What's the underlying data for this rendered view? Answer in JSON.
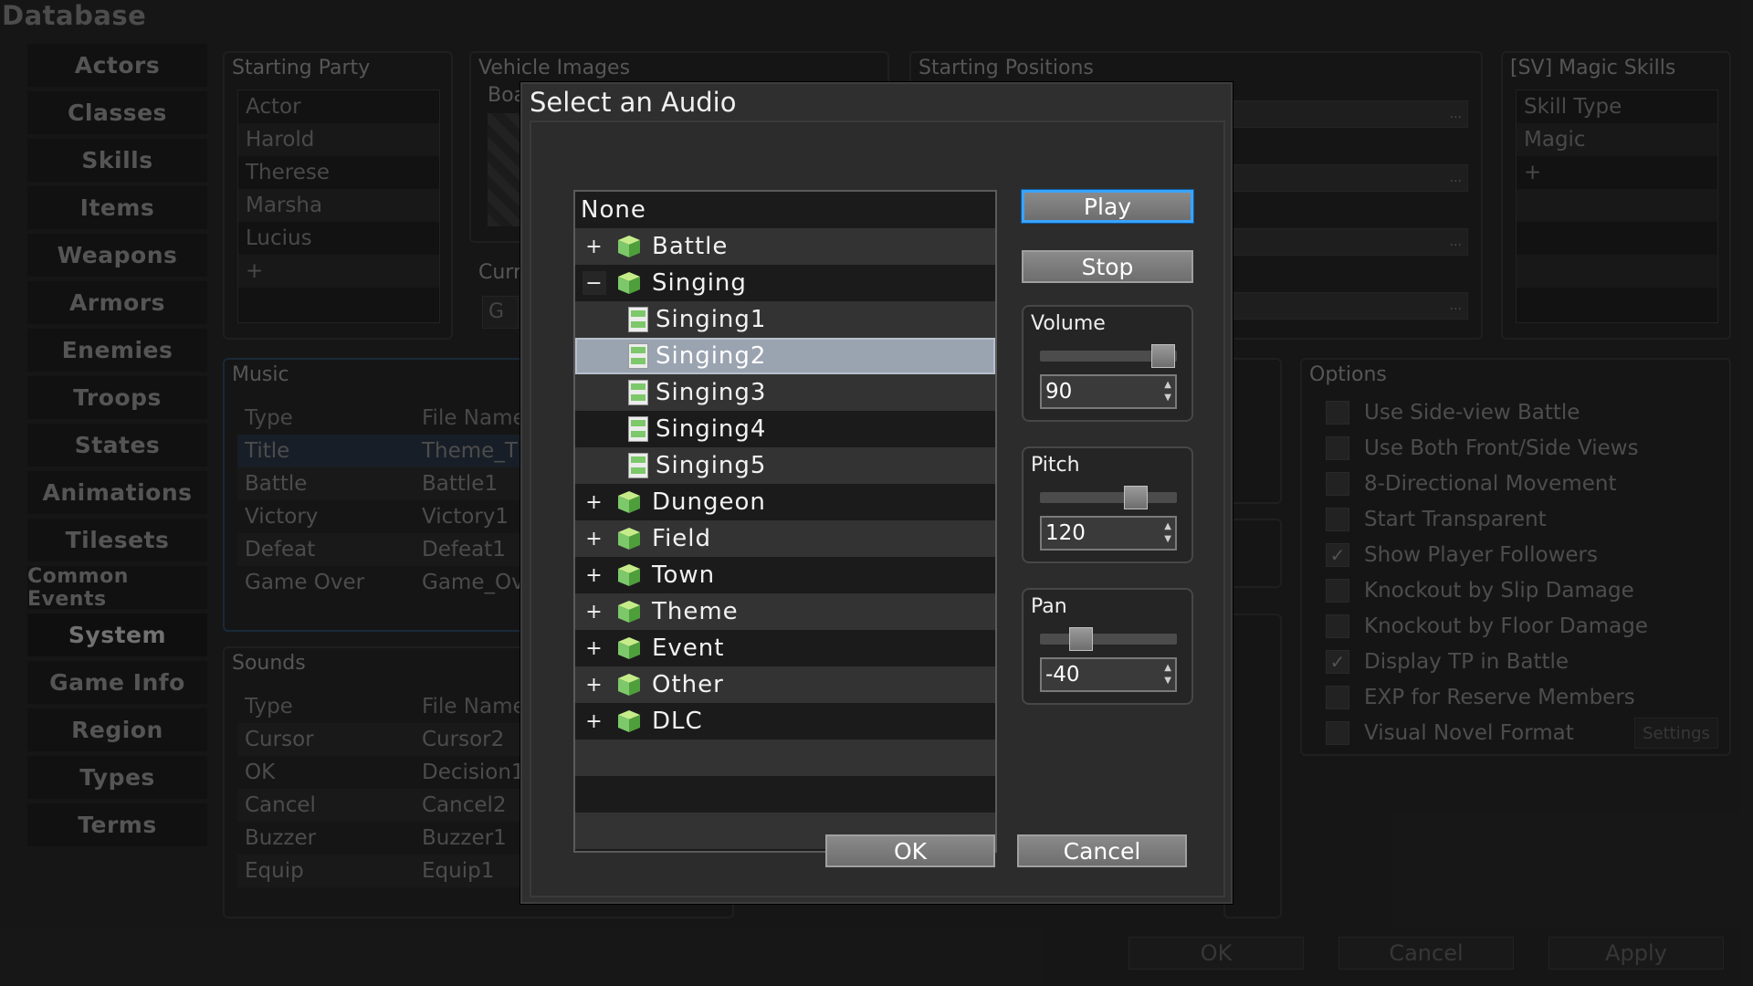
{
  "window": {
    "title": "Database"
  },
  "sidebar": {
    "items": [
      {
        "label": "Actors"
      },
      {
        "label": "Classes"
      },
      {
        "label": "Skills"
      },
      {
        "label": "Items"
      },
      {
        "label": "Weapons"
      },
      {
        "label": "Armors"
      },
      {
        "label": "Enemies"
      },
      {
        "label": "Troops"
      },
      {
        "label": "States"
      },
      {
        "label": "Animations"
      },
      {
        "label": "Tilesets"
      },
      {
        "label": "Common Events"
      },
      {
        "label": "System"
      },
      {
        "label": "Game Info"
      },
      {
        "label": "Region"
      },
      {
        "label": "Types"
      },
      {
        "label": "Terms"
      }
    ],
    "selected": "System"
  },
  "starting_party": {
    "title": "Starting Party",
    "header": "Actor",
    "rows": [
      "Harold",
      "Therese",
      "Marsha",
      "Lucius"
    ],
    "add_symbol": "+"
  },
  "vehicle_images": {
    "title": "Vehicle Images",
    "truncated_label": "Boa"
  },
  "currency": {
    "truncated_label": "Curr",
    "value_partial": "G"
  },
  "starting_positions": {
    "title": "Starting Positions",
    "button_symbol": "..."
  },
  "magic_skills": {
    "title": "[SV] Magic Skills",
    "header": "Skill Type",
    "rows": [
      "Magic"
    ],
    "add_symbol": "+"
  },
  "music": {
    "title": "Music",
    "headers": [
      "Type",
      "File Name"
    ],
    "rows": [
      [
        "Title",
        "Theme_T"
      ],
      [
        "Battle",
        "Battle1"
      ],
      [
        "Victory",
        "Victory1"
      ],
      [
        "Defeat",
        "Defeat1"
      ],
      [
        "Game Over",
        "Game_Ov"
      ]
    ]
  },
  "sounds": {
    "title": "Sounds",
    "headers": [
      "Type",
      "File Name"
    ],
    "rows": [
      [
        "Cursor",
        "Cursor2"
      ],
      [
        "OK",
        "Decision1"
      ],
      [
        "Cancel",
        "Cancel2"
      ],
      [
        "Buzzer",
        "Buzzer1"
      ],
      [
        "Equip",
        "Equip1"
      ]
    ]
  },
  "options": {
    "title": "Options",
    "items": [
      {
        "label": "Use Side-view Battle",
        "checked": false
      },
      {
        "label": "Use Both Front/Side Views",
        "checked": false
      },
      {
        "label": "8-Directional Movement",
        "checked": false
      },
      {
        "label": "Start Transparent",
        "checked": false
      },
      {
        "label": "Show Player Followers",
        "checked": true
      },
      {
        "label": "Knockout by Slip Damage",
        "checked": false
      },
      {
        "label": "Knockout by Floor Damage",
        "checked": false
      },
      {
        "label": "Display TP in Battle",
        "checked": true
      },
      {
        "label": "EXP for Reserve Members",
        "checked": false
      },
      {
        "label": "Visual Novel Format",
        "checked": false
      }
    ],
    "settings_label": "Settings",
    "check_symbol": "✓"
  },
  "footer": {
    "ok": "OK",
    "cancel": "Cancel",
    "apply": "Apply"
  },
  "audio_dialog": {
    "title": "Select an Audio",
    "tree": {
      "none_label": "None",
      "expand_symbol": "+",
      "collapse_symbol": "−",
      "folders_before": [
        {
          "label": "Battle"
        }
      ],
      "open_folder": {
        "label": "Singing"
      },
      "files": [
        {
          "label": "Singing1"
        },
        {
          "label": "Singing2"
        },
        {
          "label": "Singing3"
        },
        {
          "label": "Singing4"
        },
        {
          "label": "Singing5"
        }
      ],
      "selected_file": "Singing2",
      "folders_after": [
        {
          "label": "Dungeon"
        },
        {
          "label": "Field"
        },
        {
          "label": "Town"
        },
        {
          "label": "Theme"
        },
        {
          "label": "Event"
        },
        {
          "label": "Other"
        },
        {
          "label": "DLC"
        }
      ]
    },
    "play_label": "Play",
    "stop_label": "Stop",
    "volume": {
      "label": "Volume",
      "value": "90",
      "min": 0,
      "max": 100,
      "level": 90
    },
    "pitch": {
      "label": "Pitch",
      "value": "120",
      "min": 50,
      "max": 150,
      "level": 120
    },
    "pan": {
      "label": "Pan",
      "value": "-40",
      "min": -100,
      "max": 100,
      "level": -40
    },
    "ok_label": "OK",
    "cancel_label": "Cancel"
  },
  "colors": {
    "primary_button_border": "#3aa4ff",
    "selection_row": "#9aa3b0",
    "folder_green": "#7cc86a",
    "dialog_bg": "#2f2f2f"
  }
}
